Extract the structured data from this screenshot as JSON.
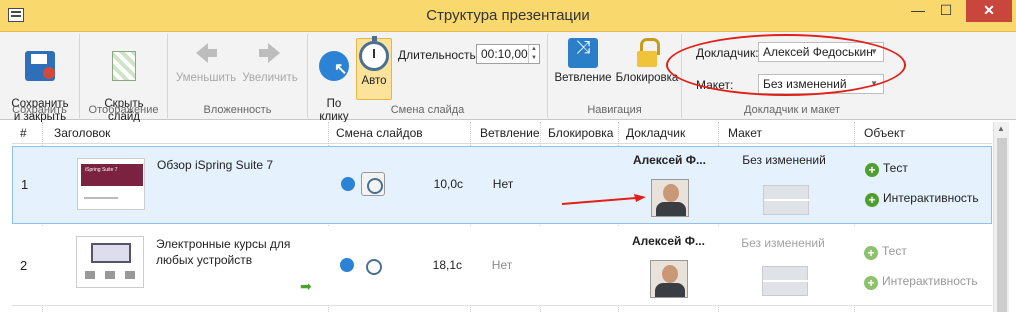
{
  "window": {
    "title": "Структура презентации",
    "controls": {
      "minimize": "—",
      "maximize": "☐",
      "close": "✕"
    }
  },
  "ribbon": {
    "groups": {
      "save": {
        "label": "Сохранить",
        "button": "Сохранить\nи закрыть"
      },
      "display": {
        "label": "Отображение",
        "button": "Скрыть\nслайд"
      },
      "nesting": {
        "label": "Вложенность",
        "decrease": "Уменьшить",
        "increase": "Увеличить"
      },
      "slide_change": {
        "label": "Смена слайда",
        "on_click": "По\nклику",
        "auto": "Авто",
        "duration_label": "Длительность:",
        "duration_value": "00:10,00"
      },
      "navigation": {
        "label": "Навигация",
        "branching": "Ветвление",
        "locking": "Блокировка"
      },
      "narrator_layout": {
        "label": "Докладчик и макет",
        "narrator_label": "Докладчик:",
        "narrator_value": "Алексей Федоськин",
        "layout_label": "Макет:",
        "layout_value": "Без изменений"
      }
    }
  },
  "table": {
    "headers": [
      "#",
      "Заголовок",
      "Смена слайдов",
      "Ветвление",
      "Блокировка",
      "Докладчик",
      "Макет",
      "Объект"
    ],
    "rows": [
      {
        "num": "1",
        "title": "Обзор iSpring Suite 7",
        "thumb_text": "iSpring Suite 7",
        "timing": "10,0с",
        "branch": "Нет",
        "narrator": "Алексей Ф...",
        "layout": "Без изменений",
        "objects": [
          "Тест",
          "Интерактивность"
        ]
      },
      {
        "num": "2",
        "title": "Электронные курсы для любых устройств",
        "timing": "18,1с",
        "branch": "Нет",
        "narrator": "Алексей Ф...",
        "layout": "Без изменений",
        "objects": [
          "Тест",
          "Интерактивность"
        ]
      }
    ]
  },
  "colors": {
    "title_bar": "#f9d86d",
    "close_button": "#c9463d",
    "selected_row": "#e5f2fd",
    "annotation_red": "#e22018",
    "add_icon_green": "#4f9e2f"
  },
  "icons": [
    "app-icon",
    "save-icon",
    "hide-slide-icon",
    "decrease-nesting-icon",
    "increase-nesting-icon",
    "on-click-icon",
    "auto-timer-icon",
    "branching-icon",
    "lock-icon",
    "plus-icon",
    "next-arrow-icon"
  ]
}
